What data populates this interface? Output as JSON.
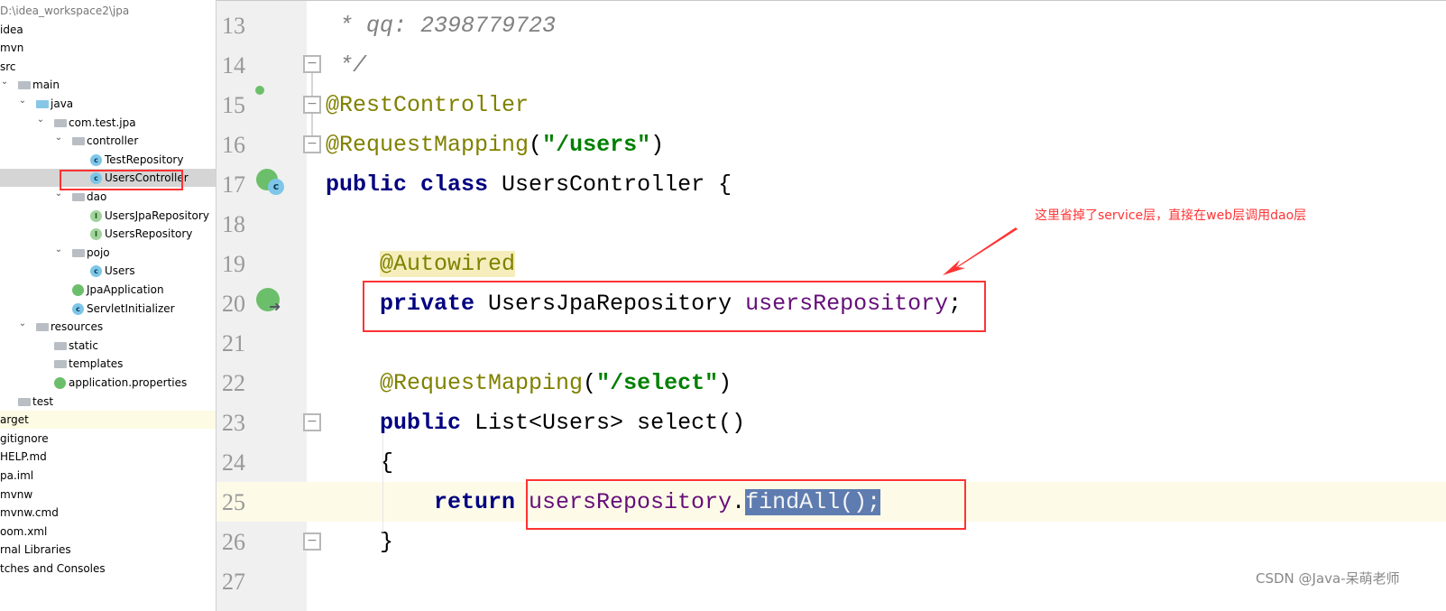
{
  "project_tree": {
    "items": [
      {
        "label": "D:\\idea_workspace2\\jpa",
        "indent": 0,
        "icon": "none",
        "chevron": false,
        "muted": true
      },
      {
        "label": "idea",
        "indent": 0,
        "icon": "none"
      },
      {
        "label": "mvn",
        "indent": 0,
        "icon": "none"
      },
      {
        "label": "src",
        "indent": 0,
        "icon": "none"
      },
      {
        "label": "main",
        "indent": 1,
        "icon": "folder",
        "chevron": true
      },
      {
        "label": "java",
        "indent": 2,
        "icon": "folder-source",
        "chevron": true
      },
      {
        "label": "com.test.jpa",
        "indent": 3,
        "icon": "package",
        "chevron": true
      },
      {
        "label": "controller",
        "indent": 4,
        "icon": "package",
        "chevron": true
      },
      {
        "label": "TestRepository",
        "indent": 5,
        "icon": "class"
      },
      {
        "label": "UsersController",
        "indent": 5,
        "icon": "class",
        "selected": true
      },
      {
        "label": "dao",
        "indent": 4,
        "icon": "package",
        "chevron": true
      },
      {
        "label": "UsersJpaRepository",
        "indent": 5,
        "icon": "interface"
      },
      {
        "label": "UsersRepository",
        "indent": 5,
        "icon": "interface"
      },
      {
        "label": "pojo",
        "indent": 4,
        "icon": "package",
        "chevron": true
      },
      {
        "label": "Users",
        "indent": 5,
        "icon": "class"
      },
      {
        "label": "JpaApplication",
        "indent": 4,
        "icon": "spring-boot-class"
      },
      {
        "label": "ServletInitializer",
        "indent": 4,
        "icon": "class"
      },
      {
        "label": "resources",
        "indent": 2,
        "icon": "folder-resources",
        "chevron": true
      },
      {
        "label": "static",
        "indent": 3,
        "icon": "package"
      },
      {
        "label": "templates",
        "indent": 3,
        "icon": "package"
      },
      {
        "label": "application.properties",
        "indent": 3,
        "icon": "spring-properties"
      },
      {
        "label": "test",
        "indent": 1,
        "icon": "folder"
      },
      {
        "label": "arget",
        "indent": 0,
        "icon": "none",
        "highlight": true
      },
      {
        "label": "gitignore",
        "indent": 0,
        "icon": "none"
      },
      {
        "label": "HELP.md",
        "indent": 0,
        "icon": "none"
      },
      {
        "label": "pa.iml",
        "indent": 0,
        "icon": "none"
      },
      {
        "label": "mvnw",
        "indent": 0,
        "icon": "none"
      },
      {
        "label": "mvnw.cmd",
        "indent": 0,
        "icon": "none"
      },
      {
        "label": "oom.xml",
        "indent": 0,
        "icon": "none"
      },
      {
        "label": "rnal Libraries",
        "indent": 0,
        "icon": "none"
      },
      {
        "label": "tches and Consoles",
        "indent": 0,
        "icon": "none"
      }
    ]
  },
  "editor": {
    "lines": [
      {
        "num": "13",
        "indent": 0,
        "tokens": [
          {
            "t": " * qq: 2398779723",
            "c": "cmt"
          }
        ]
      },
      {
        "num": "14",
        "indent": 0,
        "tokens": [
          {
            "t": " */",
            "c": "cmt"
          }
        ]
      },
      {
        "num": "15",
        "indent": 0,
        "tokens": [
          {
            "t": "@RestController",
            "c": "ann"
          }
        ]
      },
      {
        "num": "16",
        "indent": 0,
        "tokens": [
          {
            "t": "@RequestMapping",
            "c": "ann"
          },
          {
            "t": "(",
            "c": "plain"
          },
          {
            "t": "\"/users\"",
            "c": "str"
          },
          {
            "t": ")",
            "c": "plain"
          }
        ]
      },
      {
        "num": "17",
        "indent": 0,
        "tokens": [
          {
            "t": "public class ",
            "c": "kw"
          },
          {
            "t": "UsersController {",
            "c": "plain"
          }
        ]
      },
      {
        "num": "18",
        "indent": 0,
        "tokens": []
      },
      {
        "num": "19",
        "indent": 1,
        "tokens": [
          {
            "t": "@Autowired",
            "c": "ann awhl"
          }
        ]
      },
      {
        "num": "20",
        "indent": 1,
        "tokens": [
          {
            "t": "private ",
            "c": "kw"
          },
          {
            "t": "UsersJpaRepository ",
            "c": "plain"
          },
          {
            "t": "usersRepository",
            "c": "fld"
          },
          {
            "t": ";",
            "c": "plain"
          }
        ]
      },
      {
        "num": "21",
        "indent": 0,
        "tokens": []
      },
      {
        "num": "22",
        "indent": 1,
        "tokens": [
          {
            "t": "@RequestMapping",
            "c": "ann"
          },
          {
            "t": "(",
            "c": "plain"
          },
          {
            "t": "\"/select\"",
            "c": "str"
          },
          {
            "t": ")",
            "c": "plain"
          }
        ]
      },
      {
        "num": "23",
        "indent": 1,
        "tokens": [
          {
            "t": "public ",
            "c": "kw"
          },
          {
            "t": "List<Users> select()",
            "c": "plain"
          }
        ]
      },
      {
        "num": "24",
        "indent": 1,
        "tokens": [
          {
            "t": "{",
            "c": "plain"
          }
        ]
      },
      {
        "num": "25",
        "indent": 2,
        "tokens": [
          {
            "t": "return ",
            "c": "kw"
          },
          {
            "t": "usersRepository",
            "c": "fld"
          },
          {
            "t": ".",
            "c": "plain"
          },
          {
            "t": "findAll();",
            "c": "selx"
          }
        ]
      },
      {
        "num": "26",
        "indent": 1,
        "tokens": [
          {
            "t": "}",
            "c": "plain"
          }
        ]
      },
      {
        "num": "27",
        "indent": 0,
        "tokens": []
      }
    ]
  },
  "annotation": {
    "note": "这里省掉了service层，直接在web层调用dao层",
    "color": "#ff3333"
  },
  "watermark": "CSDN @Java-呆萌老师"
}
